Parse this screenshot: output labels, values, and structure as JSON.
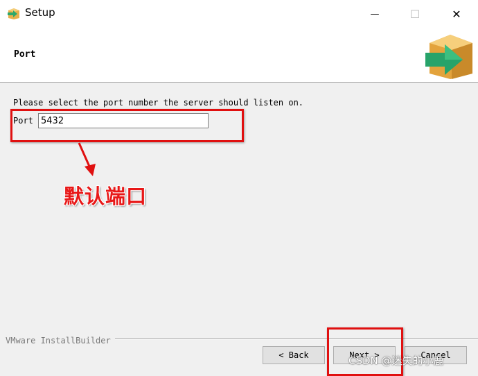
{
  "window": {
    "title": "Setup",
    "minimize_glyph": "—",
    "maximize_glyph": "☐",
    "close_glyph": "✕"
  },
  "header": {
    "title": "Port",
    "logo_icon": "installer-box-arrow-icon"
  },
  "content": {
    "prompt": "Please select the port number the server should listen on.",
    "port_label": "Port",
    "port_value": "5432"
  },
  "annotation": {
    "text": "默认端口",
    "color": "#e01010"
  },
  "footer": {
    "brand": "VMware InstallBuilder",
    "back_label": "< Back",
    "next_label": "Next >",
    "cancel_label": "Cancel"
  },
  "watermark": "CSDN @迷失的小鹿"
}
